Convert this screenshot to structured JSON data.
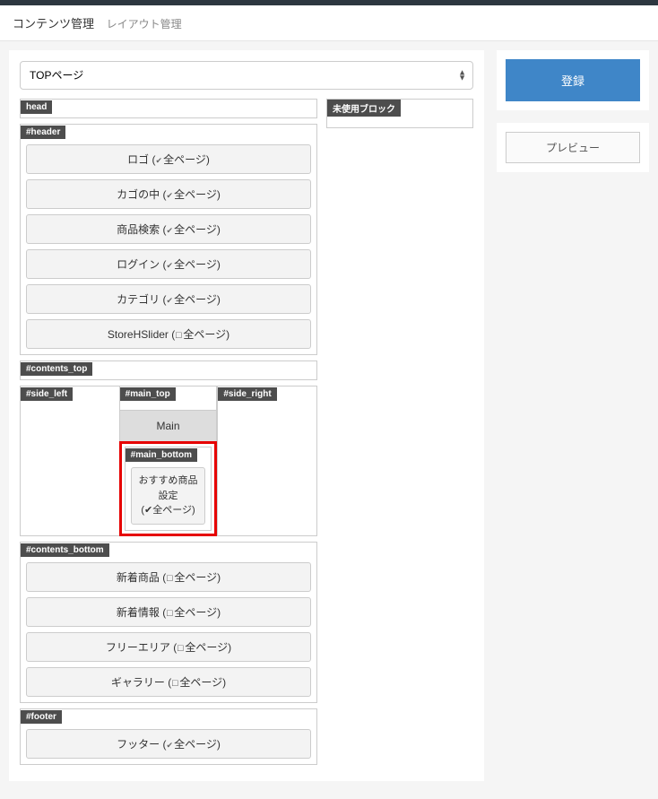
{
  "breadcrumb": {
    "main": "コンテンツ管理",
    "sub": "レイアウト管理"
  },
  "page_select": {
    "value": "TOPページ"
  },
  "zones": {
    "head": "head",
    "header": "#header",
    "contents_top": "#contents_top",
    "side_left": "#side_left",
    "main_top": "#main_top",
    "side_right": "#side_right",
    "main_bottom": "#main_bottom",
    "contents_bottom": "#contents_bottom",
    "footer": "#footer",
    "unused": "未使用ブロック"
  },
  "main_label": "Main",
  "header_blocks": [
    {
      "label": "ロゴ",
      "all": true,
      "suffix": "全ページ"
    },
    {
      "label": "カゴの中",
      "all": true,
      "suffix": "全ページ"
    },
    {
      "label": "商品検索",
      "all": true,
      "suffix": "全ページ"
    },
    {
      "label": "ログイン",
      "all": true,
      "suffix": "全ページ"
    },
    {
      "label": "カテゴリ",
      "all": true,
      "suffix": "全ページ"
    },
    {
      "label": "StoreHSlider",
      "all": false,
      "suffix": "全ページ"
    }
  ],
  "main_bottom_block": {
    "label": "おすすめ商品設定",
    "all": true,
    "suffix": "全ページ"
  },
  "contents_bottom_blocks": [
    {
      "label": "新着商品",
      "all": false,
      "suffix": "全ページ"
    },
    {
      "label": "新着情報",
      "all": false,
      "suffix": "全ページ"
    },
    {
      "label": "フリーエリア",
      "all": false,
      "suffix": "全ページ"
    },
    {
      "label": "ギャラリー",
      "all": false,
      "suffix": "全ページ"
    }
  ],
  "footer_blocks": [
    {
      "label": "フッター",
      "all": true,
      "suffix": "全ページ"
    }
  ],
  "buttons": {
    "register": "登録",
    "preview": "プレビュー"
  }
}
